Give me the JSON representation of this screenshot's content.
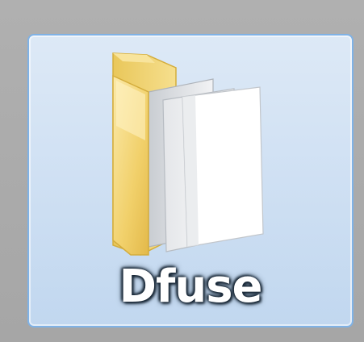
{
  "desktop": {
    "items": [
      {
        "label": "Dfuse",
        "icon": "folder-icon",
        "selected": true
      }
    ]
  },
  "colors": {
    "selection_border": "#7fb2e6",
    "selection_fill": "#cfe0f3",
    "folder_yellow": "#f2d675",
    "desktop_bg": "#a8a8a8"
  }
}
